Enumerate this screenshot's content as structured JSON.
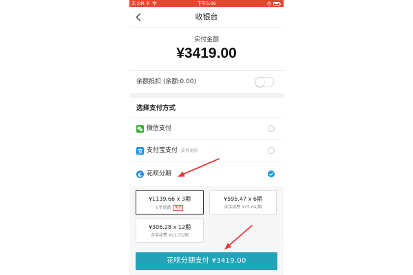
{
  "status_bar": {
    "carrier": "无 SIM 卡",
    "time": "下午5:06",
    "icons": [
      "wifi-icon",
      "alarm-icon",
      "battery-icon"
    ]
  },
  "nav": {
    "back_icon": "back-chevron-icon",
    "title": "收银台"
  },
  "amount": {
    "label": "实付金额",
    "value": "¥3419.00"
  },
  "balance": {
    "label": "余额抵扣 (余额:0.00)",
    "enabled": false
  },
  "payment": {
    "section_title": "选择支付方式",
    "methods": [
      {
        "icon": "wechat-pay-icon",
        "name": "微信支付",
        "selected": false
      },
      {
        "icon": "alipay-icon",
        "name": "支付宝支付",
        "note": "支持花呗",
        "selected": false
      },
      {
        "icon": "huabei-icon",
        "name": "花呗分期",
        "selected": true
      }
    ]
  },
  "installments": [
    {
      "amount": "¥1139.66 x 3期",
      "fee": "0手续费",
      "badge": "免息",
      "selected": true
    },
    {
      "amount": "¥595.47 x 6期",
      "fee": "含手续费 ¥25.64/期",
      "selected": false
    },
    {
      "amount": "¥306.28 x 12期",
      "fee": "含手续费 ¥21.37/期",
      "selected": false
    }
  ],
  "pay_button": {
    "label": "花呗分期支付 ¥3419.00"
  },
  "colors": {
    "status_bar": "#e8452f",
    "accent": "#22a3b7",
    "check": "#1e9bd7",
    "badge_red": "#e8452f",
    "wechat": "#3cb034",
    "alipay": "#1a8fe3",
    "huabei": "#2a8ee0",
    "annotation_arrow": "#e53935"
  }
}
